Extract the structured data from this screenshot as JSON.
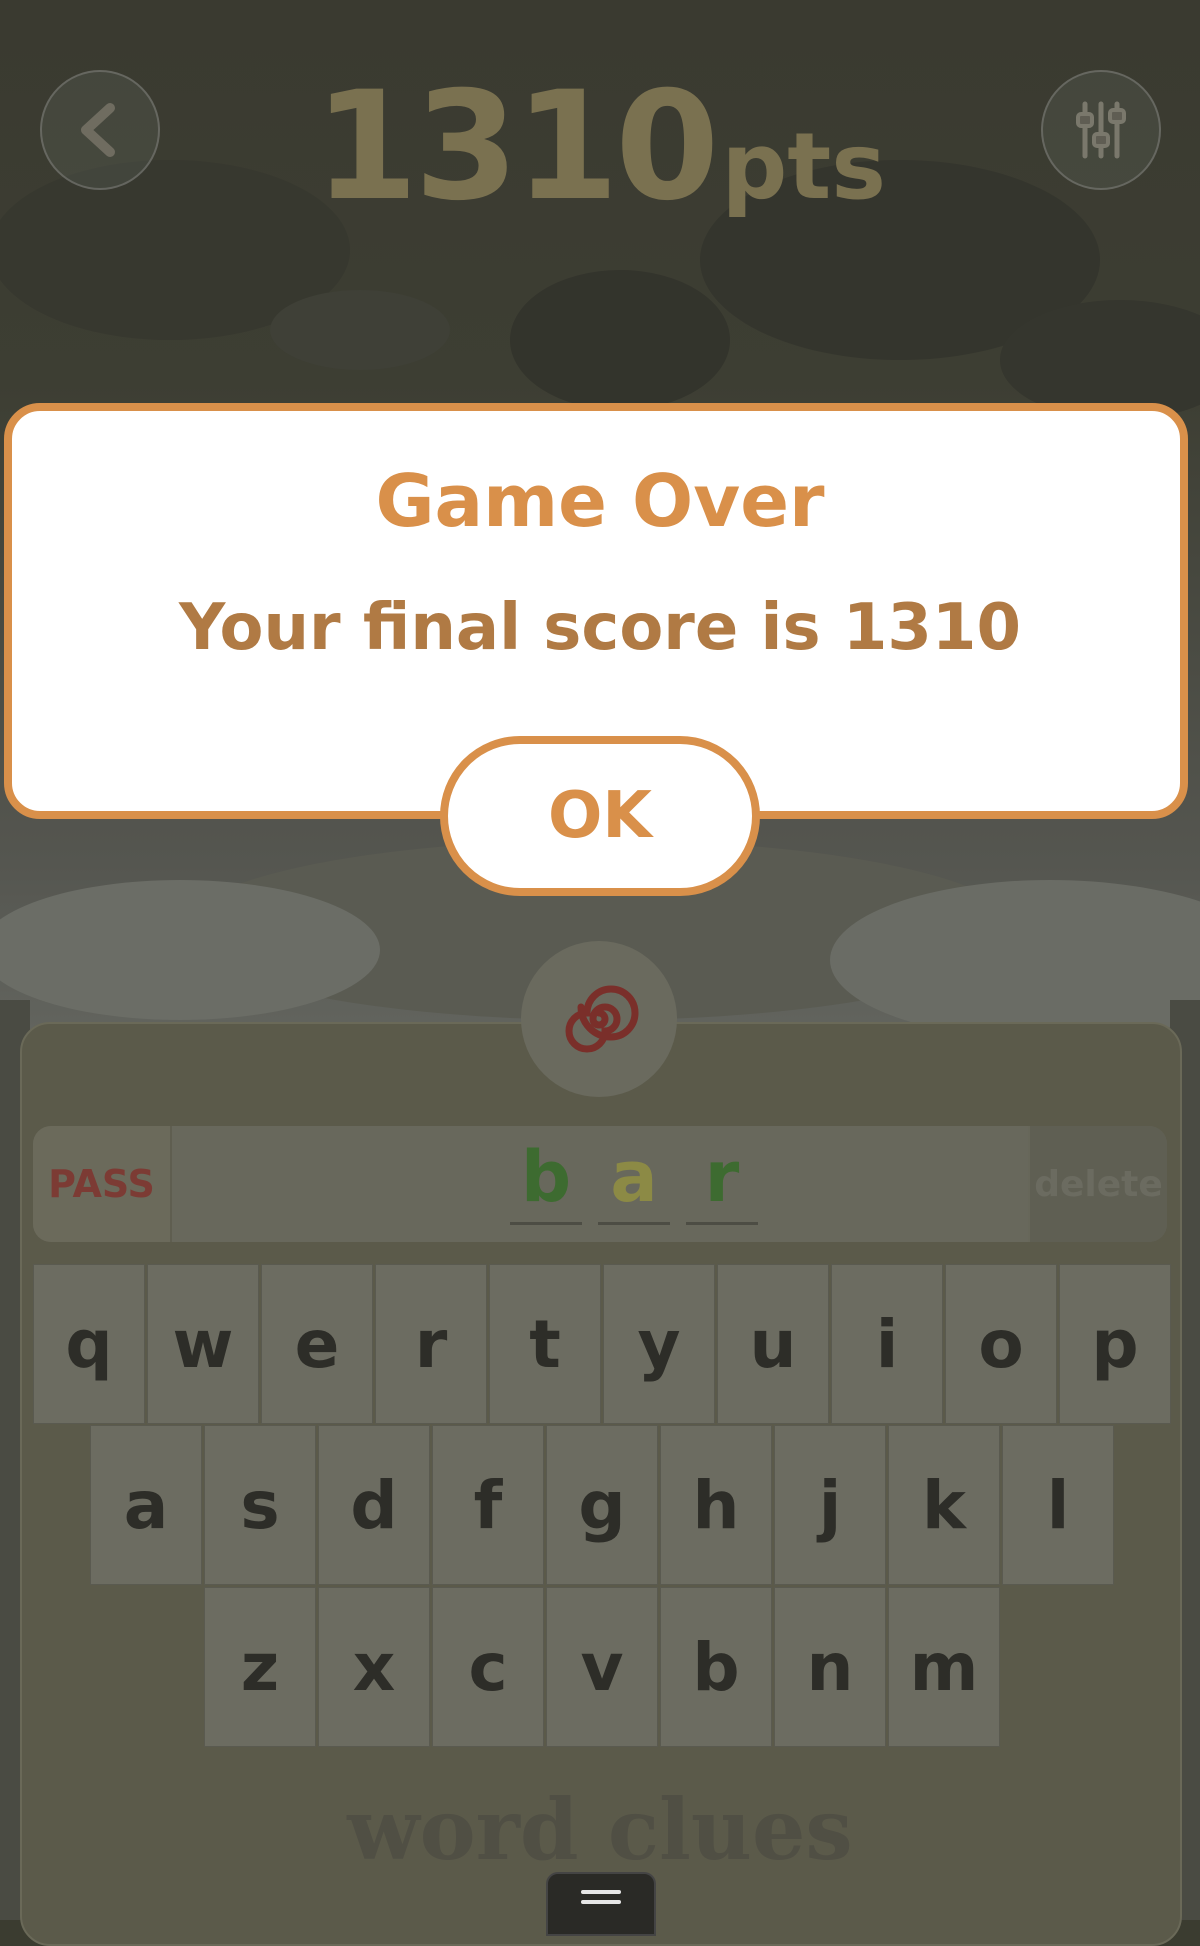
{
  "header": {
    "score_value": "1310",
    "score_unit": "pts"
  },
  "game": {
    "pass_label": "PASS",
    "delete_label": "delete",
    "word_letters": [
      {
        "letter": "b",
        "color": "#3d6b30"
      },
      {
        "letter": "a",
        "color": "#8c8a45"
      },
      {
        "letter": "r",
        "color": "#3d6b30"
      }
    ],
    "keyboard": {
      "row1": [
        "q",
        "w",
        "e",
        "r",
        "t",
        "y",
        "u",
        "i",
        "o",
        "p"
      ],
      "row2": [
        "a",
        "s",
        "d",
        "f",
        "g",
        "h",
        "j",
        "k",
        "l"
      ],
      "row3": [
        "z",
        "x",
        "c",
        "v",
        "b",
        "n",
        "m"
      ]
    },
    "footer_title": "word clues"
  },
  "dialog": {
    "title": "Game Over",
    "message": "Your final score is 1310",
    "ok_label": "OK"
  },
  "colors": {
    "accent": "#d9904a",
    "message": "#b07a44",
    "pass": "#7c3b34"
  },
  "icons": {
    "back": "chevron-left-icon",
    "settings": "sliders-icon",
    "hint": "spiral-icon",
    "menu": "hamburger-icon"
  }
}
